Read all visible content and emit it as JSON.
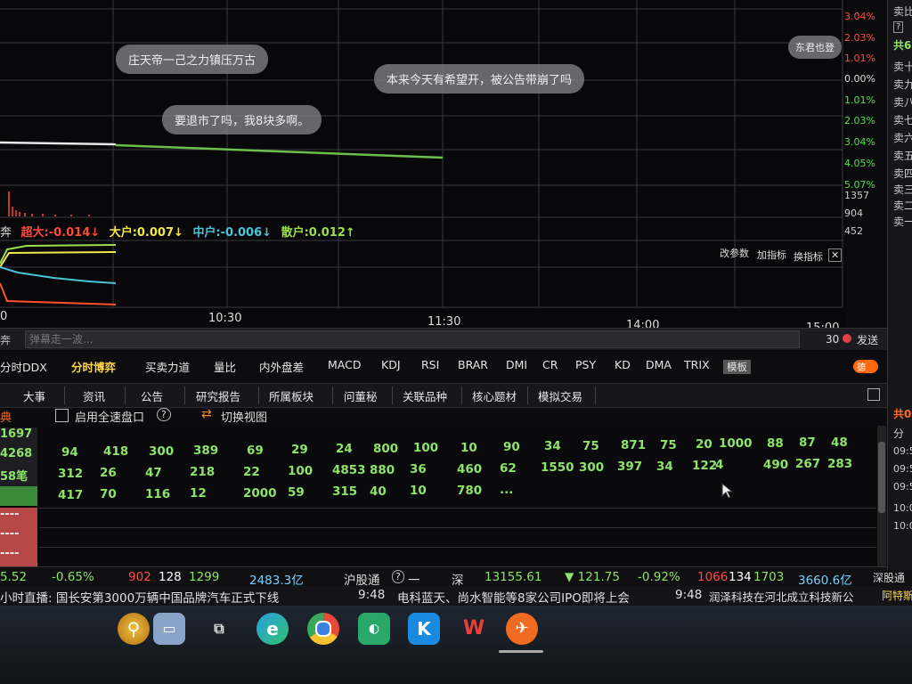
{
  "danmaku": {
    "bubbles": [
      "庄天帝一己之力镇压万古",
      "本来今天有希望开，被公告带崩了吗",
      "要退市了吗，我8块多啊。",
      "东君也登"
    ],
    "input_placeholder": "弹幕走一波...",
    "count": "30",
    "send_label": "发送"
  },
  "price_scale": [
    {
      "label": "3.04%",
      "color": "#ff4a4a"
    },
    {
      "label": "2.03%",
      "color": "#ff4a4a"
    },
    {
      "label": "1.01%",
      "color": "#ff4a4a"
    },
    {
      "label": "0.00%",
      "color": "#dddddd"
    },
    {
      "label": "1.01%",
      "color": "#4ce04c"
    },
    {
      "label": "2.03%",
      "color": "#4ce04c"
    },
    {
      "label": "3.04%",
      "color": "#4ce04c"
    },
    {
      "label": "4.05%",
      "color": "#4ce04c"
    },
    {
      "label": "5.07%",
      "color": "#4ce04c"
    }
  ],
  "volume_scale": [
    "1357",
    "904",
    "452"
  ],
  "time_axis": [
    "0",
    "10:30",
    "11:30",
    "14:00",
    "15:00"
  ],
  "fund_flow": {
    "prefix": "奔",
    "super": "超大:-0.014↓",
    "large": "大户:0.007↓",
    "medium": "中户:-0.006↓",
    "retail": "散户:0.012↑"
  },
  "chart_controls": {
    "params": "改参数",
    "add": "加指标",
    "switch": "换指标",
    "close": "✕"
  },
  "indicators": [
    "分时DDX",
    "分时博弈",
    "买卖力道",
    "量比",
    "内外盘差",
    "MACD",
    "KDJ",
    "RSI",
    "BRAR",
    "DMI",
    "CR",
    "PSY",
    "KD",
    "DMA",
    "TRIX",
    "模板"
  ],
  "indicator_toggle": "德",
  "tabs": [
    "大事",
    "资讯",
    "公告",
    "研究报告",
    "所属板块",
    "问董秘",
    "关联品种",
    "核心题材",
    "模拟交易"
  ],
  "options": {
    "prefix": "典",
    "full_speed": "启用全速盘口",
    "help": "?",
    "switch_view": "切换视图"
  },
  "left_values": [
    "1697",
    "4268",
    "58笔"
  ],
  "left_placeholders": [
    "----",
    "----",
    "----",
    "----"
  ],
  "trade_rows": [
    [
      "94",
      "418",
      "300",
      "389",
      "69",
      "29",
      "24",
      "800",
      "100",
      "10",
      "90",
      "34",
      "75",
      "871",
      "75",
      "20",
      "1000",
      "88",
      "87",
      "48"
    ],
    [
      "312",
      "26",
      "47",
      "218",
      "22",
      "100",
      "4853",
      "880",
      "36",
      "460",
      "62",
      "1550",
      "300",
      "397",
      "34",
      "122",
      "4",
      "490",
      "267",
      "283"
    ],
    [
      "417",
      "70",
      "116",
      "12",
      "2000",
      "59",
      "315",
      "40",
      "10",
      "780",
      "..."
    ]
  ],
  "status_bar": {
    "value_a": "5.52",
    "pct_a": "-0.65%",
    "up_a": "902",
    "flat_a": "128",
    "down_a": "1299",
    "amount_a": "2483.3亿",
    "hgt_label": "沪股通",
    "hgt_value": "一",
    "sz_label": "深",
    "sz_index": "13155.61",
    "sz_change": "▼ 121.75",
    "sz_pct": "-0.92%",
    "sz_up": "1066",
    "sz_flat": "134",
    "sz_down": "1703",
    "sz_amount": "3660.6亿",
    "sgt_label": "深股通"
  },
  "news": [
    {
      "text": "小时直播: 国长安第3000万辆中国品牌汽车正式下线"
    },
    {
      "time": "9:48",
      "text": "电科蓝天、尚水智能等8家公司IPO即将上会"
    },
    {
      "time": "9:48",
      "text": "润泽科技在河北成立科技新公"
    },
    {
      "text": "阿特斯"
    }
  ],
  "right_panel": {
    "top": "卖比",
    "help": "?",
    "total": "共6",
    "sell_levels": [
      "卖十",
      "卖九",
      "卖八",
      "卖七",
      "卖六",
      "卖五",
      "卖四",
      "卖三",
      "卖二",
      "卖一"
    ],
    "total2": "共0",
    "fen": "分",
    "times": [
      "09:5",
      "09:5",
      "09:5",
      "10:0",
      "10:0"
    ]
  },
  "taskbar_icons": [
    "search-icon",
    "laptop-icon",
    "task-view-icon",
    "edge-icon",
    "chrome-icon",
    "wechat-icon",
    "app-k-icon",
    "wps-icon",
    "app-orange-icon"
  ]
}
